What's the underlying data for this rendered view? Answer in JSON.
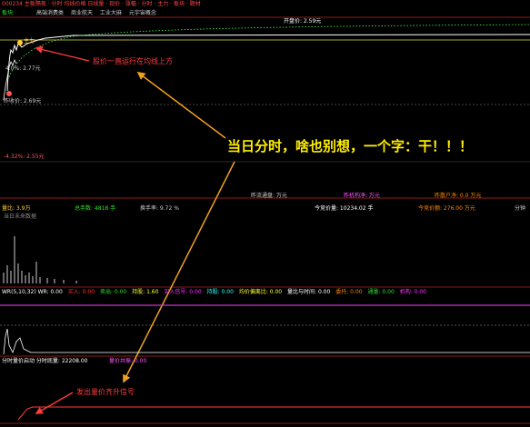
{
  "header": {
    "line1": "000234 主板隔夜 · 分时 均线价格 日线量 · 现价 · 涨幅 · 分时 · 主力 · 板块 · 题材",
    "line2_label": "板块:",
    "line2_tabs": [
      "高端消费类",
      "商业航天",
      "工业大麻",
      "元宇宙概念"
    ]
  },
  "main_chart": {
    "price_label_top": "开盘价: 2.59元",
    "avg_label": "主力",
    "label_left_mid": "4.0%: 2.77元",
    "label_bottom": "昨收价: 2.69元",
    "label_pct": "-4.32%: 2.55元",
    "annotation_arrow1": "股价一直运行在均线上方",
    "big_caption": "当日分时，啥也别想，一个字：干！！！"
  },
  "info_row": {
    "items": [
      {
        "label": "昨流通盘: 万元",
        "color": "#cccccc"
      },
      {
        "label": "昨机构净: 万元",
        "color": "#ff55ff"
      },
      {
        "label": "昨散户净: 0.0 万元",
        "color": "#ff8800"
      }
    ]
  },
  "stats_row": {
    "left": "量比: 3.9万",
    "left2": "当日未来数据",
    "mid1": "总手数: 4818 手",
    "mid2": "换手率: 9.72 %",
    "right1": "今竞价量: 10234.02 手",
    "right2": "今竞价额: 276.00 万元",
    "right3": "分钟"
  },
  "indicator_row": {
    "items": [
      {
        "text": "WR(5,10,32)  WR: 0.00",
        "color": "#ffffff"
      },
      {
        "text": "买入: 0.00",
        "color": "#ff3333"
      },
      {
        "text": "卖出: 0.00",
        "color": "#33dd33"
      },
      {
        "text": "持股: 1.60",
        "color": "#ffff33"
      },
      {
        "text": "买入信号: 0.00",
        "color": "#ff33ff"
      },
      {
        "text": "持股: 0.00",
        "color": "#33ffff"
      },
      {
        "text": "均价偏离比: 0.00",
        "color": "#ffff33"
      },
      {
        "text": "量比与时间: 0.00",
        "color": "#ffffff"
      },
      {
        "text": "委托: 0.00",
        "color": "#ff8800"
      },
      {
        "text": "通量: 0.00",
        "color": "#33dd33"
      },
      {
        "text": "机构: 0.00",
        "color": "#ff33ff"
      }
    ]
  },
  "volume_panel": {
    "title": "分时量价启动  分时底量: 22208.00",
    "signal_label": "量价共振: 0.00",
    "annotation_arrow2": "发出量价齐升信号"
  },
  "colors": {
    "annotation_red": "#ff3b3b",
    "caption_yellow": "#ffee00",
    "arrow_orange": "#f0a020",
    "separator_red": "#8b1a1a",
    "magenta_line": "#cc33cc"
  }
}
